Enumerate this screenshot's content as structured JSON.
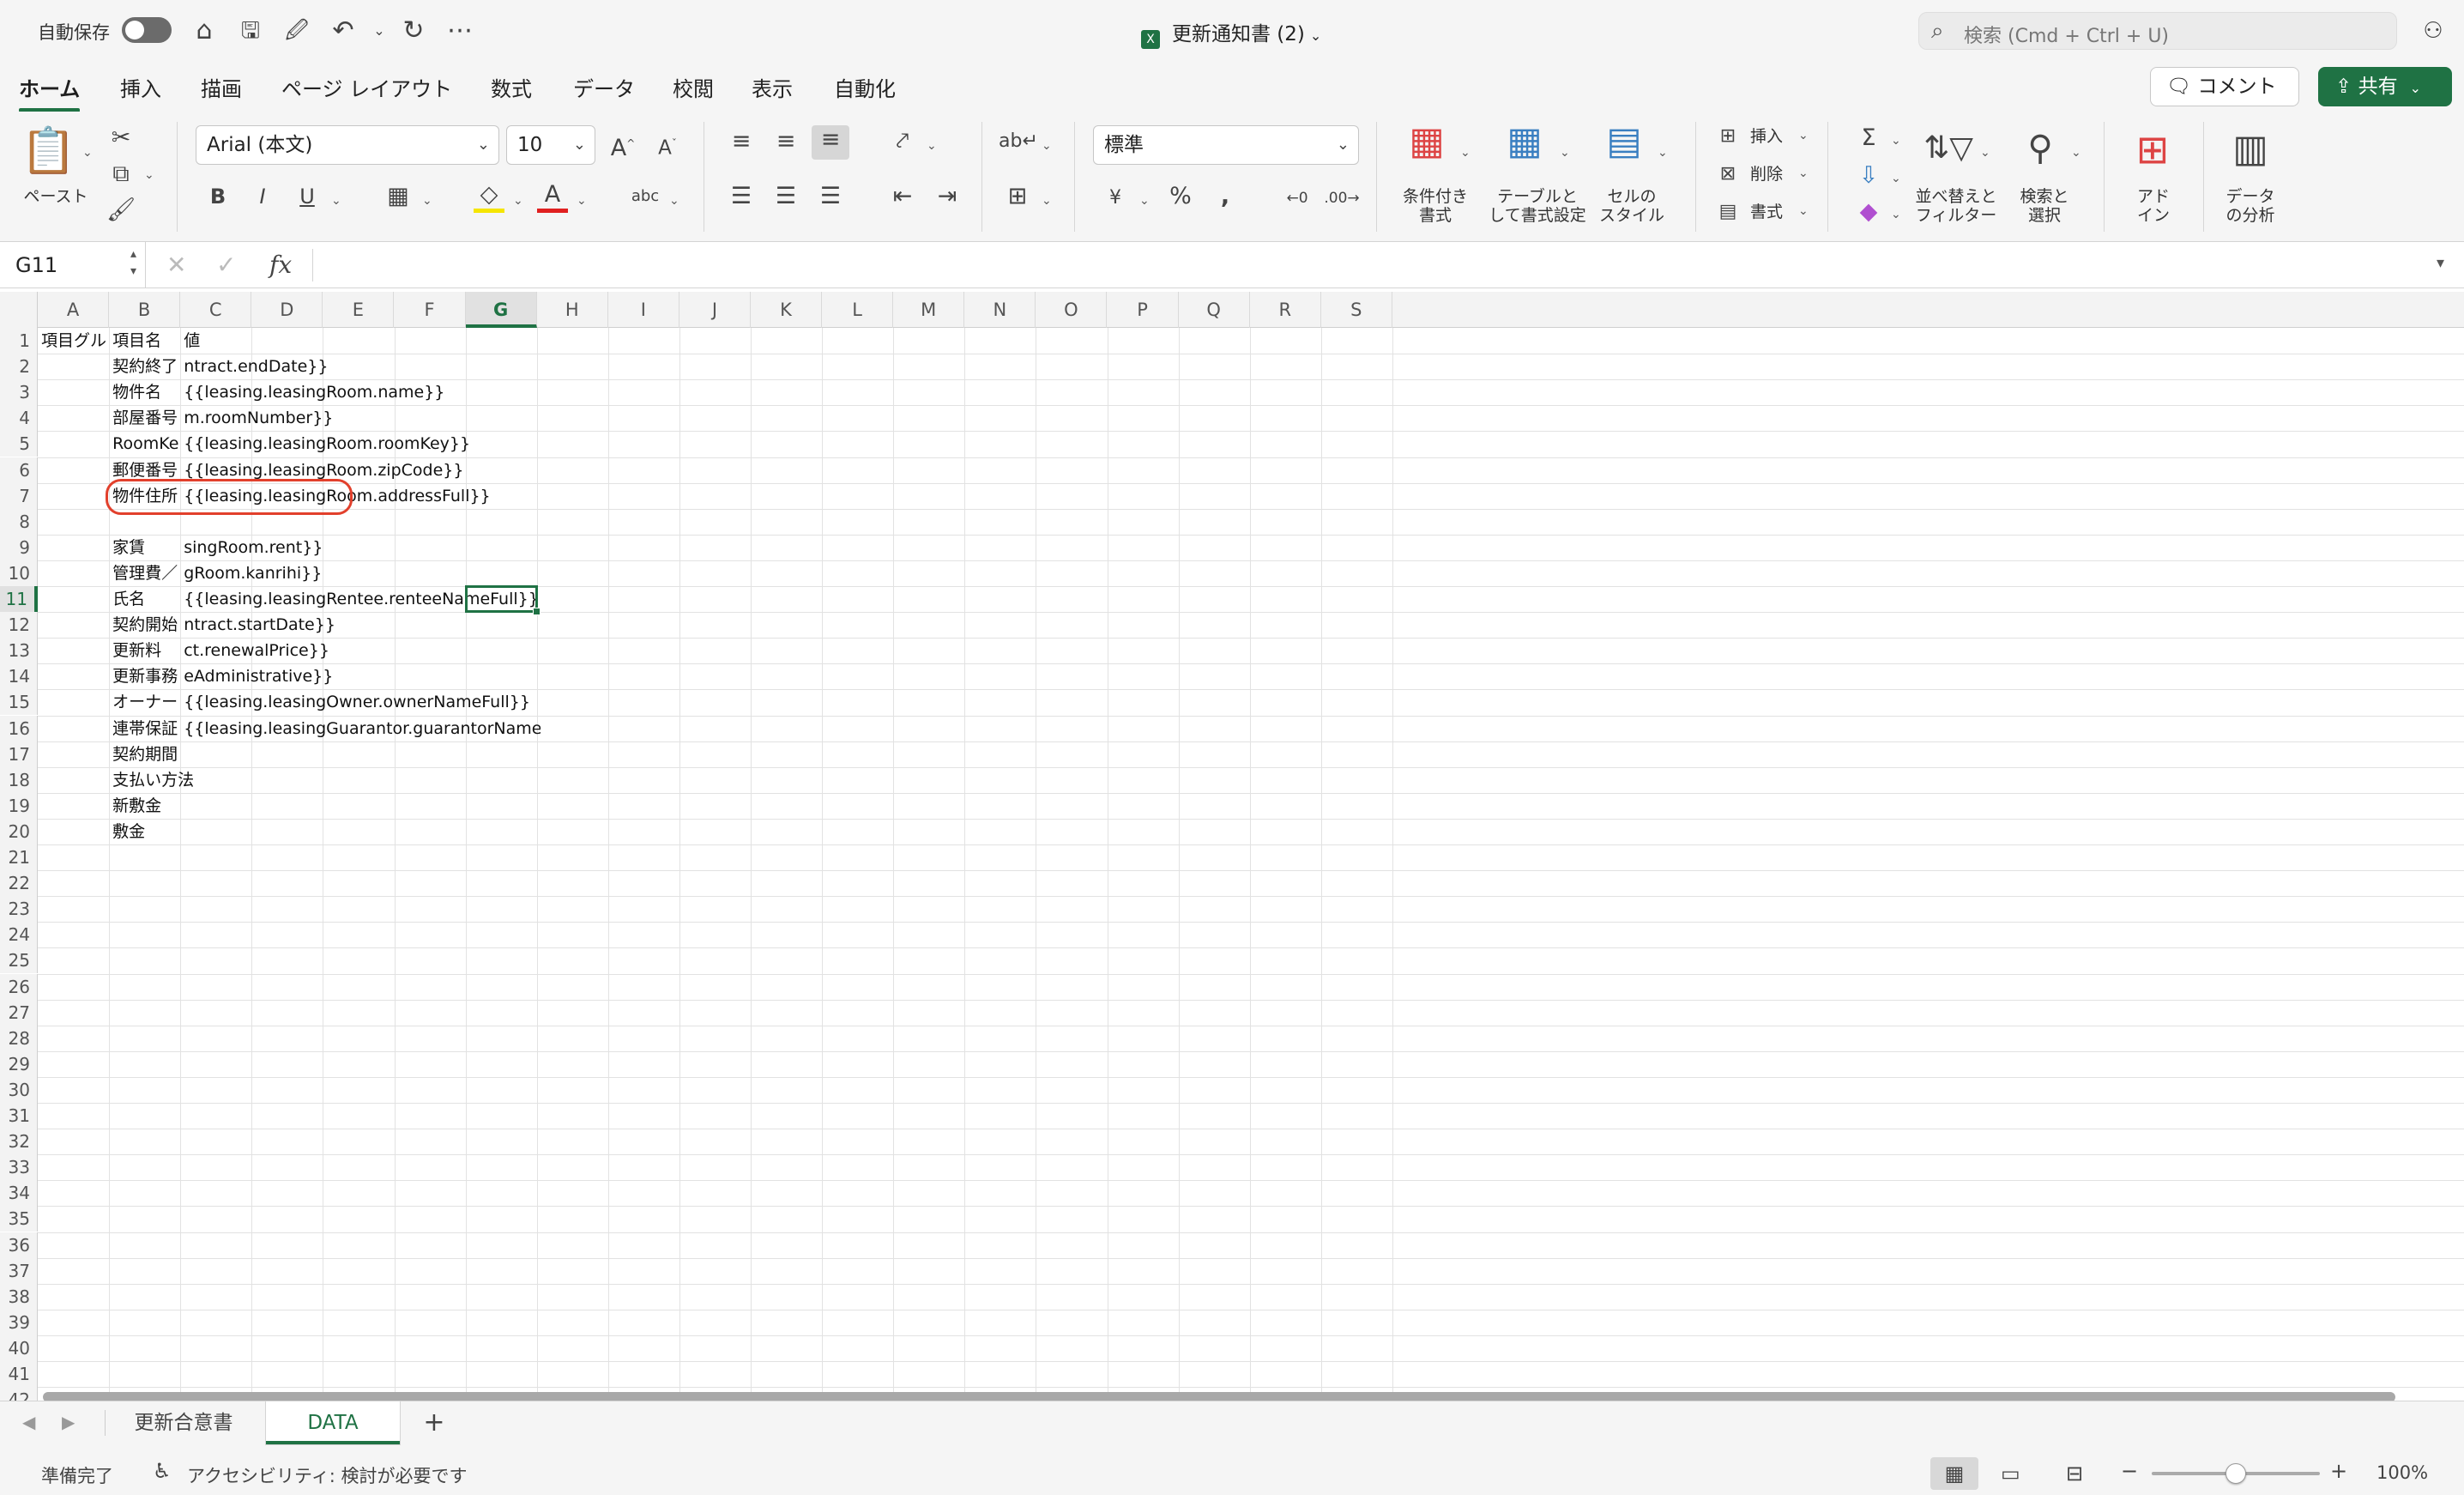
{
  "titlebar": {
    "autosave_label": "自動保存",
    "doc_title": "更新通知書 (2)",
    "search_placeholder": "検索 (Cmd + Ctrl + U)"
  },
  "ribbon_tabs": [
    "ホーム",
    "挿入",
    "描画",
    "ページ レイアウト",
    "数式",
    "データ",
    "校閲",
    "表示",
    "自動化"
  ],
  "active_tab": "ホーム",
  "comment_label": "コメント",
  "share_label": "共有",
  "ribbon": {
    "paste_label": "ペースト",
    "font_name": "Arial (本文)",
    "font_size": "10",
    "number_format": "標準",
    "conditional_format_label": "条件付き\n書式",
    "table_format_label": "テーブルと\nして書式設定",
    "cell_style_label": "セルの\nスタイル",
    "insert_label": "挿入",
    "delete_label": "削除",
    "format_label": "書式",
    "sort_filter_label": "並べ替えと\nフィルター",
    "find_select_label": "検索と\n選択",
    "addin_label": "アド\nイン",
    "analyze_label": "データ\nの分析"
  },
  "formula_bar": {
    "name_box": "G11",
    "fx": "fx",
    "formula": ""
  },
  "columns": [
    "A",
    "B",
    "C",
    "D",
    "E",
    "F",
    "G",
    "H",
    "I",
    "J",
    "K",
    "L",
    "M",
    "N",
    "O",
    "P",
    "Q",
    "R",
    "S"
  ],
  "selected_column": "G",
  "selected_row": "11",
  "rows": [
    "1",
    "2",
    "3",
    "4",
    "5",
    "6",
    "7",
    "8",
    "9",
    "10",
    "11",
    "12",
    "13",
    "14",
    "15",
    "16",
    "17",
    "18",
    "19",
    "20",
    "21",
    "22",
    "23",
    "24",
    "25",
    "26",
    "27",
    "28",
    "29",
    "30",
    "31",
    "32",
    "33",
    "34",
    "35",
    "36",
    "37",
    "38",
    "39",
    "40",
    "41",
    "42"
  ],
  "cells": {
    "A1": "項目グループ",
    "B1": "項目名",
    "C1": "値",
    "B2": "契約終了日",
    "C2": "ntract.endDate}}",
    "B3": "物件名",
    "C3": "{{leasing.leasingRoom.name}}",
    "B4": "部屋番号",
    "C4": "m.roomNumber}}",
    "B5": "RoomKey",
    "C5": "{{leasing.leasingRoom.roomKey}}",
    "B6": "郵便番号",
    "C6": "{{leasing.leasingRoom.zipCode}}",
    "B7": "物件住所",
    "C7": "{{leasing.leasingRoom.addressFull}}",
    "B9": "家賃",
    "C9": "singRoom.rent}}",
    "B10": "管理費／共益費",
    "C10": "gRoom.kanrihi}}",
    "B11": "氏名",
    "C11": "{{leasing.leasingRentee.renteeNameFull}}",
    "B12": "契約開始日",
    "C12": "ntract.startDate}}",
    "B13": "更新料",
    "C13": "ct.renewalPrice}}",
    "B14": "更新事務手数料",
    "C14": "eAdministrative}}",
    "B15": "オーナー名",
    "C15": "{{leasing.leasingOwner.ownerNameFull}}",
    "B16": "連帯保証人",
    "C16": "{{leasing.leasingGuarantor.guarantorNameFull}}",
    "B17": "契約期間",
    "B18": "支払い方法",
    "B19": "新敷金",
    "B20": "敷金"
  },
  "sheets": [
    "更新合意書",
    "DATA"
  ],
  "active_sheet": "DATA",
  "add_sheet": "+",
  "status": {
    "ready": "準備完了",
    "accessibility": "アクセシビリティ: 検討が必要です",
    "zoom_minus": "−",
    "zoom_plus": "+",
    "zoom": "100%",
    "zoom_level": 0.5
  },
  "colors": {
    "accent": "#1f7244",
    "highlight_oval": "#e2402c"
  }
}
